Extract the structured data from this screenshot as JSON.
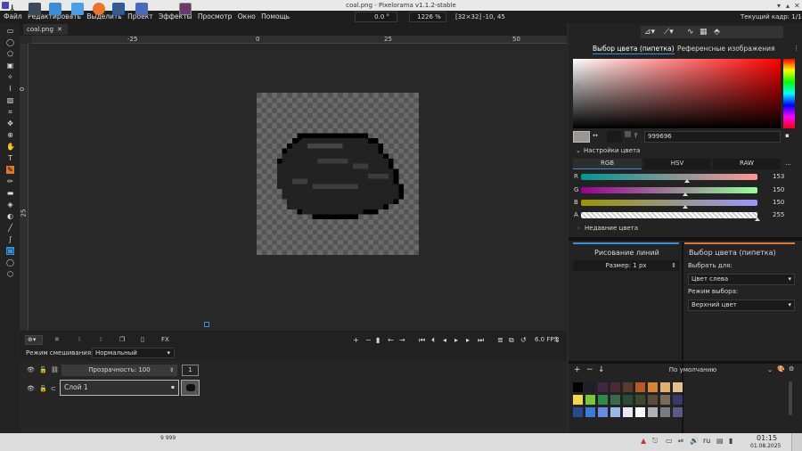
{
  "window": {
    "title": "coal.png - Pixelorama v1.1.2-stable"
  },
  "menu": [
    "Файл",
    "Редактировать",
    "Выделить",
    "Проект",
    "Эффекты",
    "Просмотр",
    "Окно",
    "Помощь"
  ],
  "toolbar_info": {
    "rotation": "0.0 °",
    "zoom": "1226 %",
    "size": "[32×32]",
    "cursor": "-10, 45",
    "current_frame": "Текущий кадр: 1/1"
  },
  "tab": {
    "label": "coal.png",
    "close": "✕"
  },
  "ruler_h": [
    "-25",
    "0",
    "25",
    "50"
  ],
  "ruler_v": [
    "0",
    "25"
  ],
  "tools": [
    "select-rect-icon",
    "select-ellipse-icon",
    "select-poly-icon",
    "select-color-icon",
    "magic-wand-icon",
    "lasso-icon",
    "paint-select-icon",
    "crop-icon",
    "move-icon",
    "zoom-icon",
    "pan-icon",
    "text-icon",
    "color-picker-icon",
    "pencil-icon",
    "eraser-icon",
    "bucket-icon",
    "shading-icon",
    "line-icon",
    "curve-icon",
    "rect-icon",
    "ellipse-icon",
    "shape-icon"
  ],
  "blend": {
    "label": "Режим смешивания:",
    "value": "Нормальный"
  },
  "playback": {
    "fps": "6.0 FPS"
  },
  "layers": {
    "opacity_label": "Прозрачность: 100",
    "frame_num": "1",
    "layer_name": "Слой 1"
  },
  "right": {
    "tab_picker": "Выбор цвета (пипетка)",
    "tab_refs": "Референсные изображения",
    "hex": "999696",
    "color_settings": "Настройки цвета",
    "modes": [
      "RGB",
      "HSV",
      "RAW"
    ],
    "more": "...",
    "channels": [
      {
        "name": "R",
        "value": "153"
      },
      {
        "name": "G",
        "value": "150"
      },
      {
        "name": "B",
        "value": "150"
      },
      {
        "name": "A",
        "value": "255"
      }
    ],
    "channel_fracs": [
      0.6,
      0.59,
      0.59,
      1.0
    ],
    "recent": "Недавние цвета",
    "left_tool": {
      "title": "Рисование линий",
      "size": "Размер: 1 px"
    },
    "right_tool": {
      "title": "Выбор цвета (пипетка)",
      "pick_for_label": "Выбрать для:",
      "pick_for": "Цвет слева",
      "mode_label": "Режим выбора:",
      "mode": "Верхний цвет"
    },
    "palette_name": "По умолчанию",
    "palette_colors": [
      "#000000",
      "#1d1d2b",
      "#3f2743",
      "#4a2a35",
      "#5a3a2a",
      "#b65a2a",
      "#d8823a",
      "#e0b070",
      "#e8c090",
      "#f0d84a",
      "#7ac83a",
      "#2e8a4a",
      "#3a6a4a",
      "#2a4a3a",
      "#3a4a2a",
      "#5a4a3a",
      "#7a6a5a",
      "#3a3a6a",
      "#2a4a8a",
      "#3a7ad8",
      "#6a8ae8",
      "#9ab8e8",
      "#e8e8f8",
      "#ffffff",
      "#b0b0b8",
      "#7a7a82",
      "#5a5a8a"
    ]
  },
  "taskbar": {
    "lang": "ru",
    "time": "01:15",
    "date": "01.08.2025",
    "badge": "9 999"
  }
}
